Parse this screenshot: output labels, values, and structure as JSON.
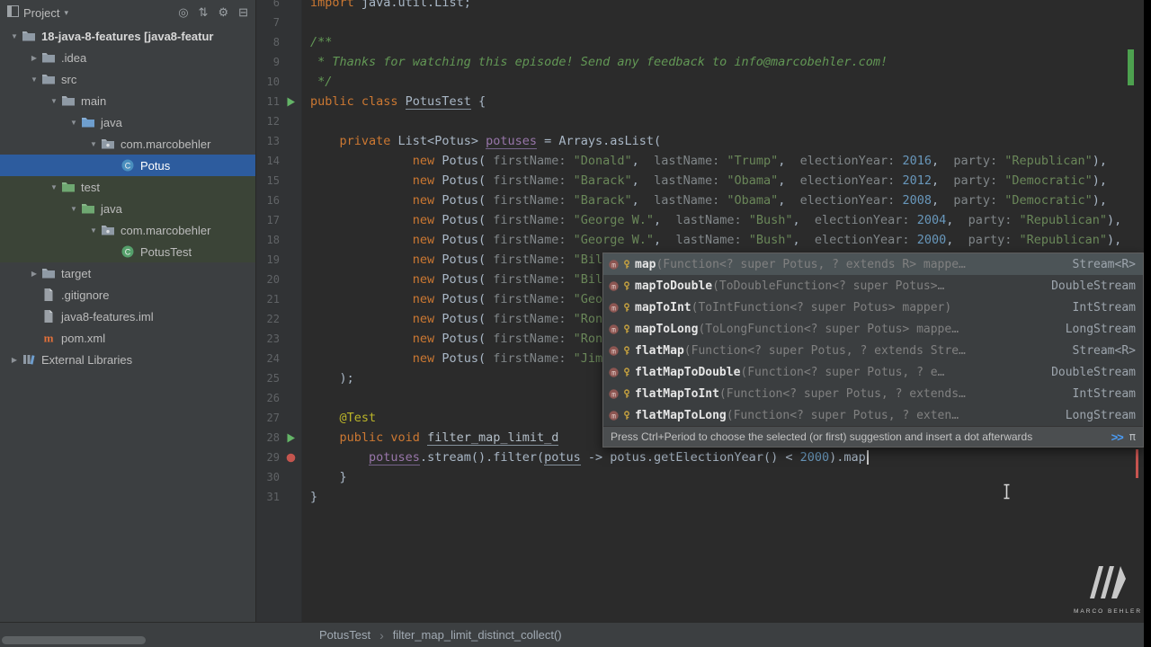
{
  "project_panel": {
    "header": {
      "title": "Project",
      "caret": "▾",
      "icons": [
        {
          "name": "locate-icon",
          "glyph": "◎"
        },
        {
          "name": "collapse-all-icon",
          "glyph": "⇅"
        },
        {
          "name": "settings-icon",
          "glyph": "⚙"
        },
        {
          "name": "hide-panel-icon",
          "glyph": "⊟"
        }
      ]
    },
    "tree": [
      {
        "label": "18-java-8-features [java8-featur",
        "indent": 0,
        "arrow": "down",
        "icon": "folder-project",
        "bold": true
      },
      {
        "label": ".idea",
        "indent": 1,
        "arrow": "right",
        "icon": "folder"
      },
      {
        "label": "src",
        "indent": 1,
        "arrow": "down",
        "icon": "folder"
      },
      {
        "label": "main",
        "indent": 2,
        "arrow": "down",
        "icon": "folder"
      },
      {
        "label": "java",
        "indent": 3,
        "arrow": "down",
        "icon": "folder-source"
      },
      {
        "label": "com.marcobehler",
        "indent": 4,
        "arrow": "down",
        "icon": "package"
      },
      {
        "label": "Potus",
        "indent": 5,
        "arrow": null,
        "icon": "class",
        "selected": true
      },
      {
        "label": "test",
        "indent": 2,
        "arrow": "down",
        "icon": "folder-test",
        "highlight": true
      },
      {
        "label": "java",
        "indent": 3,
        "arrow": "down",
        "icon": "folder-test",
        "highlight": true
      },
      {
        "label": "com.marcobehler",
        "indent": 4,
        "arrow": "down",
        "icon": "package",
        "highlight": true
      },
      {
        "label": "PotusTest",
        "indent": 5,
        "arrow": null,
        "icon": "class-test",
        "highlight": true
      },
      {
        "label": "target",
        "indent": 1,
        "arrow": "right",
        "icon": "folder"
      },
      {
        "label": ".gitignore",
        "indent": 1,
        "arrow": null,
        "icon": "file"
      },
      {
        "label": "java8-features.iml",
        "indent": 1,
        "arrow": null,
        "icon": "file"
      },
      {
        "label": "pom.xml",
        "indent": 1,
        "arrow": null,
        "icon": "maven"
      },
      {
        "label": "External Libraries",
        "indent": 0,
        "arrow": "right",
        "icon": "libraries"
      }
    ]
  },
  "editor": {
    "lines": [
      {
        "n": 6,
        "t": [
          [
            "k",
            "import"
          ],
          [
            "p",
            " java.util.List;"
          ]
        ]
      },
      {
        "n": 7,
        "t": []
      },
      {
        "n": 8,
        "t": [
          [
            "c",
            "/**"
          ]
        ]
      },
      {
        "n": 9,
        "t": [
          [
            "c",
            " * Thanks for watching this episode! Send any feedback to info@marcobehler.com!"
          ]
        ]
      },
      {
        "n": 10,
        "t": [
          [
            "c",
            " */"
          ]
        ]
      },
      {
        "n": 11,
        "g": "run",
        "t": [
          [
            "k",
            "public class "
          ],
          [
            "u",
            "PotusTest"
          ],
          [
            "p",
            " {"
          ]
        ]
      },
      {
        "n": 12,
        "t": []
      },
      {
        "n": 13,
        "t": [
          [
            "p",
            "    "
          ],
          [
            "k",
            "private"
          ],
          [
            "p",
            " List<Potus> "
          ],
          [
            "f",
            "potuses"
          ],
          [
            "p",
            " = Arrays.asList("
          ]
        ]
      },
      {
        "n": 14,
        "t": [
          [
            "p",
            "              "
          ],
          [
            "k",
            "new"
          ],
          [
            "p",
            " Potus("
          ],
          [
            "h",
            " firstName: "
          ],
          [
            "s",
            "\"Donald\""
          ],
          [
            "p",
            ", "
          ],
          [
            "h",
            " lastName: "
          ],
          [
            "s",
            "\"Trump\""
          ],
          [
            "p",
            ", "
          ],
          [
            "h",
            " electionYear: "
          ],
          [
            "n",
            "2016"
          ],
          [
            "p",
            ", "
          ],
          [
            "h",
            " party: "
          ],
          [
            "s",
            "\"Republican\""
          ],
          [
            "p",
            "),"
          ]
        ]
      },
      {
        "n": 15,
        "t": [
          [
            "p",
            "              "
          ],
          [
            "k",
            "new"
          ],
          [
            "p",
            " Potus("
          ],
          [
            "h",
            " firstName: "
          ],
          [
            "s",
            "\"Barack\""
          ],
          [
            "p",
            ", "
          ],
          [
            "h",
            " lastName: "
          ],
          [
            "s",
            "\"Obama\""
          ],
          [
            "p",
            ", "
          ],
          [
            "h",
            " electionYear: "
          ],
          [
            "n",
            "2012"
          ],
          [
            "p",
            ", "
          ],
          [
            "h",
            " party: "
          ],
          [
            "s",
            "\"Democratic\""
          ],
          [
            "p",
            "),"
          ]
        ]
      },
      {
        "n": 16,
        "t": [
          [
            "p",
            "              "
          ],
          [
            "k",
            "new"
          ],
          [
            "p",
            " Potus("
          ],
          [
            "h",
            " firstName: "
          ],
          [
            "s",
            "\"Barack\""
          ],
          [
            "p",
            ", "
          ],
          [
            "h",
            " lastName: "
          ],
          [
            "s",
            "\"Obama\""
          ],
          [
            "p",
            ", "
          ],
          [
            "h",
            " electionYear: "
          ],
          [
            "n",
            "2008"
          ],
          [
            "p",
            ", "
          ],
          [
            "h",
            " party: "
          ],
          [
            "s",
            "\"Democratic\""
          ],
          [
            "p",
            "),"
          ]
        ]
      },
      {
        "n": 17,
        "t": [
          [
            "p",
            "              "
          ],
          [
            "k",
            "new"
          ],
          [
            "p",
            " Potus("
          ],
          [
            "h",
            " firstName: "
          ],
          [
            "s",
            "\"George W.\""
          ],
          [
            "p",
            ", "
          ],
          [
            "h",
            " lastName: "
          ],
          [
            "s",
            "\"Bush\""
          ],
          [
            "p",
            ", "
          ],
          [
            "h",
            " electionYear: "
          ],
          [
            "n",
            "2004"
          ],
          [
            "p",
            ", "
          ],
          [
            "h",
            " party: "
          ],
          [
            "s",
            "\"Republican\""
          ],
          [
            "p",
            "),"
          ]
        ]
      },
      {
        "n": 18,
        "t": [
          [
            "p",
            "              "
          ],
          [
            "k",
            "new"
          ],
          [
            "p",
            " Potus("
          ],
          [
            "h",
            " firstName: "
          ],
          [
            "s",
            "\"George W.\""
          ],
          [
            "p",
            ", "
          ],
          [
            "h",
            " lastName: "
          ],
          [
            "s",
            "\"Bush\""
          ],
          [
            "p",
            ", "
          ],
          [
            "h",
            " electionYear: "
          ],
          [
            "n",
            "2000"
          ],
          [
            "p",
            ", "
          ],
          [
            "h",
            " party: "
          ],
          [
            "s",
            "\"Republican\""
          ],
          [
            "p",
            "),"
          ]
        ]
      },
      {
        "n": 19,
        "t": [
          [
            "p",
            "              "
          ],
          [
            "k",
            "new"
          ],
          [
            "p",
            " Potus("
          ],
          [
            "h",
            " firstName: "
          ],
          [
            "s",
            "\"Bil"
          ]
        ]
      },
      {
        "n": 20,
        "t": [
          [
            "p",
            "              "
          ],
          [
            "k",
            "new"
          ],
          [
            "p",
            " Potus("
          ],
          [
            "h",
            " firstName: "
          ],
          [
            "s",
            "\"Bil"
          ]
        ]
      },
      {
        "n": 21,
        "t": [
          [
            "p",
            "              "
          ],
          [
            "k",
            "new"
          ],
          [
            "p",
            " Potus("
          ],
          [
            "h",
            " firstName: "
          ],
          [
            "s",
            "\"Geo"
          ]
        ]
      },
      {
        "n": 22,
        "t": [
          [
            "p",
            "              "
          ],
          [
            "k",
            "new"
          ],
          [
            "p",
            " Potus("
          ],
          [
            "h",
            " firstName: "
          ],
          [
            "s",
            "\"Ron"
          ]
        ]
      },
      {
        "n": 23,
        "t": [
          [
            "p",
            "              "
          ],
          [
            "k",
            "new"
          ],
          [
            "p",
            " Potus("
          ],
          [
            "h",
            " firstName: "
          ],
          [
            "s",
            "\"Ron"
          ]
        ]
      },
      {
        "n": 24,
        "t": [
          [
            "p",
            "              "
          ],
          [
            "k",
            "new"
          ],
          [
            "p",
            " Potus("
          ],
          [
            "h",
            " firstName: "
          ],
          [
            "s",
            "\"Jim"
          ]
        ]
      },
      {
        "n": 25,
        "t": [
          [
            "p",
            "    );"
          ]
        ]
      },
      {
        "n": 26,
        "t": []
      },
      {
        "n": 27,
        "t": [
          [
            "p",
            "    "
          ],
          [
            "a",
            "@Test"
          ]
        ]
      },
      {
        "n": 28,
        "g": "run",
        "t": [
          [
            "p",
            "    "
          ],
          [
            "k",
            "public void "
          ],
          [
            "m",
            "filter_map_limit_d"
          ]
        ]
      },
      {
        "n": 29,
        "g": "red",
        "caret": true,
        "t": [
          [
            "p",
            "        "
          ],
          [
            "f",
            "potuses"
          ],
          [
            "p",
            ".stream().filter("
          ],
          [
            "u",
            "potus"
          ],
          [
            "p",
            " -> potus.getElectionYear() < "
          ],
          [
            "n",
            "2000"
          ],
          [
            "p",
            ").map"
          ]
        ]
      },
      {
        "n": 30,
        "t": [
          [
            "p",
            "    }"
          ]
        ]
      },
      {
        "n": 31,
        "t": [
          [
            "p",
            "}"
          ]
        ]
      }
    ]
  },
  "completion": {
    "items": [
      {
        "icon": "method",
        "name": "map",
        "params": "(Function<? super Potus, ? extends R> mappe…",
        "ret": "Stream<R>",
        "selected": true
      },
      {
        "icon": "method",
        "name": "mapToDouble",
        "params": "(ToDoubleFunction<? super Potus>…",
        "ret": "DoubleStream"
      },
      {
        "icon": "method",
        "name": "mapToInt",
        "params": "(ToIntFunction<? super Potus> mapper)",
        "ret": "IntStream"
      },
      {
        "icon": "method",
        "name": "mapToLong",
        "params": "(ToLongFunction<? super Potus> mappe…",
        "ret": "LongStream"
      },
      {
        "icon": "method",
        "name": "flatMap",
        "params": "(Function<? super Potus, ? extends Stre…",
        "ret": "Stream<R>"
      },
      {
        "icon": "method",
        "name": "flatMapToDouble",
        "params": "(Function<? super Potus, ? e…",
        "ret": "DoubleStream"
      },
      {
        "icon": "method",
        "name": "flatMapToInt",
        "params": "(Function<? super Potus, ? extends…",
        "ret": "IntStream"
      },
      {
        "icon": "method",
        "name": "flatMapToLong",
        "params": "(Function<? super Potus, ? exten…",
        "ret": "LongStream"
      }
    ],
    "footer": {
      "text": "Press Ctrl+Period to choose the selected (or first) suggestion and insert a dot afterwards",
      "icon1": ">>",
      "icon2": "π"
    }
  },
  "breadcrumbs": {
    "items": [
      "PotusTest",
      "filter_map_limit_distinct_collect()"
    ],
    "separator": "›"
  },
  "watermark": {
    "text": "MARCO BEHLER"
  },
  "colors": {
    "editor_bg": "#2b2b2b",
    "panel_bg": "#3c3f41",
    "selection_blue": "#2d5c9e",
    "test_highlight_green": "#3b4437",
    "keyword_orange": "#cc7832",
    "string_green": "#6a8759",
    "number_blue": "#6897bb",
    "comment_green": "#629755",
    "annotation_yellow": "#bbb529",
    "field_purple": "#9876aa"
  }
}
